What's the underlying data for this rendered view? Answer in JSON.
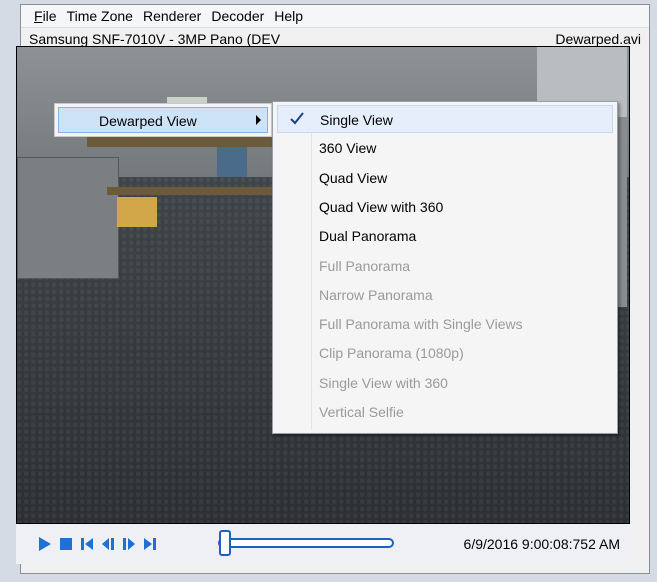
{
  "menubar": {
    "items": [
      {
        "accel": "F",
        "rest": "ile"
      },
      {
        "accel": "",
        "rest": "Time Zone"
      },
      {
        "accel": "",
        "rest": "Renderer"
      },
      {
        "accel": "",
        "rest": "Decoder"
      },
      {
        "accel": "",
        "rest": "Help"
      }
    ]
  },
  "titlebar": {
    "camera": "Samsung SNF-7010V - 3MP Pano (DEV",
    "file": "Dewarped.avi"
  },
  "context_menu": {
    "parent_label": "Dewarped View",
    "items": [
      {
        "label": "Single View",
        "enabled": true,
        "checked": true
      },
      {
        "label": "360 View",
        "enabled": true,
        "checked": false
      },
      {
        "label": "Quad View",
        "enabled": true,
        "checked": false
      },
      {
        "label": "Quad View with 360",
        "enabled": true,
        "checked": false
      },
      {
        "label": "Dual Panorama",
        "enabled": true,
        "checked": false
      },
      {
        "label": "Full Panorama",
        "enabled": false,
        "checked": false
      },
      {
        "label": "Narrow Panorama",
        "enabled": false,
        "checked": false
      },
      {
        "label": "Full Panorama with Single Views",
        "enabled": false,
        "checked": false
      },
      {
        "label": "Clip Panorama (1080p)",
        "enabled": false,
        "checked": false
      },
      {
        "label": "Single View with 360",
        "enabled": false,
        "checked": false
      },
      {
        "label": "Vertical Selfie",
        "enabled": false,
        "checked": false
      }
    ]
  },
  "controls": {
    "timestamp": "6/9/2016 9:00:08:752 AM",
    "accent": "#1f6fd6",
    "position": 0.03
  }
}
